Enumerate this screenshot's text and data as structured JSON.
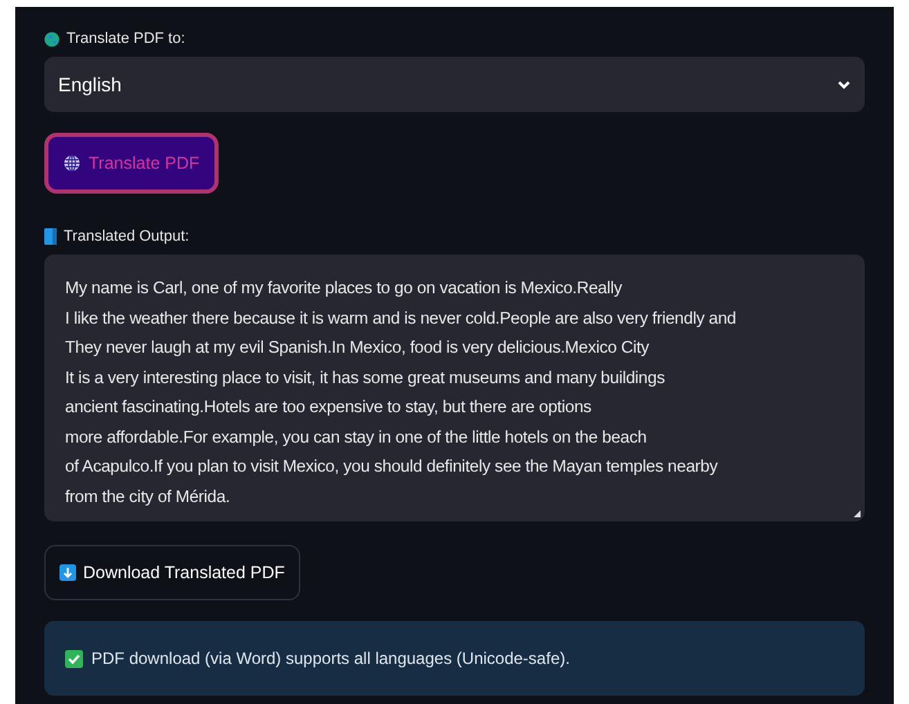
{
  "language_label": "Translate PDF to:",
  "language_select": {
    "value": "English"
  },
  "translate_button": {
    "label": "Translate PDF",
    "focused": true
  },
  "output_label": "Translated Output:",
  "output_text": {
    "value": "My name is Carl, one of my favorite places to go on vacation is Mexico.Really\nI like the weather there because it is warm and is never cold.People are also very friendly and\nThey never laugh at my evil Spanish.In Mexico, food is very delicious.Mexico City\nIt is a very interesting place to visit, it has some great museums and many buildings\nancient fascinating.Hotels are too expensive to stay, but there are options\nmore affordable.For example, you can stay in one of the little hotels on the beach\nof Acapulco.If you plan to visit Mexico, you should definitely see the Mayan temples nearby\nfrom the city of Mérida."
  },
  "download_button": {
    "label": "Download Translated PDF"
  },
  "info_message": {
    "kind": "success",
    "text": "PDF download (via Word) supports all languages (Unicode-safe)."
  }
}
